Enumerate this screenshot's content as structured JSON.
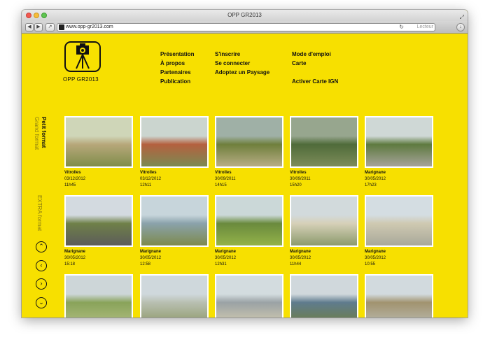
{
  "window": {
    "title": "OPP GR2013",
    "url": "www.opp-gr2013.com",
    "reader_label": "Lecteur"
  },
  "logo": {
    "caption": "OPP  GR2013"
  },
  "menu": {
    "col1": [
      "Présentation",
      "À propos",
      "Partenaires",
      "Publication"
    ],
    "col2": [
      "S'inscrire",
      "Se connecter",
      "Adoptez un Paysage"
    ],
    "col3": [
      "Mode d'emploi",
      "Carte",
      "Activer Carte IGN"
    ]
  },
  "sidebar": {
    "formats": [
      "Petit  format",
      "Grand  format",
      "EXTRA  format"
    ],
    "nav": [
      "up-icon",
      "left-icon",
      "right-icon",
      "down-icon"
    ]
  },
  "photos": [
    {
      "place": "Vitrolles",
      "date": "03/12/2012",
      "time": "11h45",
      "colors": [
        "#cfd6b8",
        "#b7a77a",
        "#7f8d4a"
      ]
    },
    {
      "place": "Vitrolles",
      "date": "03/12/2012",
      "time": "12h11",
      "colors": [
        "#cbd5cf",
        "#b4603f",
        "#7b8a52"
      ]
    },
    {
      "place": "Vitrolles",
      "date": "30/09/2011",
      "time": "14h15",
      "colors": [
        "#9fb0a6",
        "#6f7f3c",
        "#b8ad85"
      ]
    },
    {
      "place": "Vitrolles",
      "date": "30/09/2011",
      "time": "15h20",
      "colors": [
        "#97a68e",
        "#4f6b3a",
        "#7d8c5a"
      ]
    },
    {
      "place": "Marignane",
      "date": "30/05/2012",
      "time": "17h23",
      "colors": [
        "#cfd8d6",
        "#5e7a3f",
        "#a6a39a"
      ]
    },
    {
      "place": "Marignane",
      "date": "30/05/2012",
      "time": "15:18",
      "colors": [
        "#d3dae0",
        "#6f8048",
        "#5c5c5a"
      ]
    },
    {
      "place": "Marignane",
      "date": "30/05/2012",
      "time": "12:58",
      "colors": [
        "#c7d5db",
        "#8aa2ab",
        "#7d8a4d"
      ]
    },
    {
      "place": "Marignane",
      "date": "30/05/2012",
      "time": "12h31",
      "colors": [
        "#cbd8d8",
        "#6a8a3d",
        "#93b249"
      ]
    },
    {
      "place": "Marignane",
      "date": "30/05/2012",
      "time": "11h44",
      "colors": [
        "#d2dadc",
        "#d6d0b8",
        "#8b9a6c"
      ]
    },
    {
      "place": "Marignane",
      "date": "30/05/2012",
      "time": "10:55",
      "colors": [
        "#d4dde2",
        "#cfc9b1",
        "#a8a89a"
      ]
    },
    {
      "place": "",
      "date": "",
      "time": "",
      "colors": [
        "#cdd6d8",
        "#89a35a",
        "#aebc7e"
      ]
    },
    {
      "place": "",
      "date": "",
      "time": "",
      "colors": [
        "#cfd8dc",
        "#b8bfb1",
        "#8f9a6a"
      ]
    },
    {
      "place": "",
      "date": "",
      "time": "",
      "colors": [
        "#d3dcdf",
        "#9aa2a5",
        "#d3cbb0"
      ]
    },
    {
      "place": "",
      "date": "",
      "time": "",
      "colors": [
        "#d0d8dc",
        "#5f7b8d",
        "#6e7e46"
      ]
    },
    {
      "place": "",
      "date": "",
      "time": "",
      "colors": [
        "#d2dade",
        "#a1936f",
        "#b9b8ad"
      ]
    }
  ]
}
